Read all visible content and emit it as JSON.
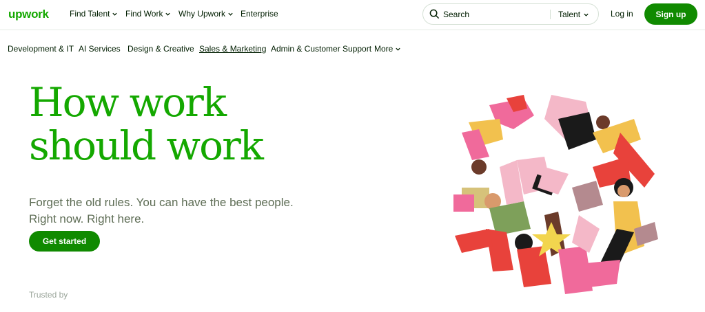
{
  "brand": {
    "logo_text": "upwork",
    "accent": "#14a800",
    "button_green": "#108a00"
  },
  "nav": {
    "find_talent": "Find Talent",
    "find_work": "Find Work",
    "why_upwork": "Why Upwork",
    "enterprise": "Enterprise"
  },
  "search": {
    "placeholder": "Search",
    "scope": "Talent"
  },
  "auth": {
    "login": "Log in",
    "signup": "Sign up"
  },
  "categories": [
    "Development & IT",
    "AI Services",
    "Design & Creative",
    "Sales & Marketing",
    "Admin & Customer Support",
    "More"
  ],
  "hero": {
    "title_line1": "How work",
    "title_line2": "should work",
    "subtitle_line1": "Forget the old rules. You can have the best people.",
    "subtitle_line2": "Right now. Right here.",
    "cta": "Get started"
  },
  "trusted_by": "Trusted by"
}
